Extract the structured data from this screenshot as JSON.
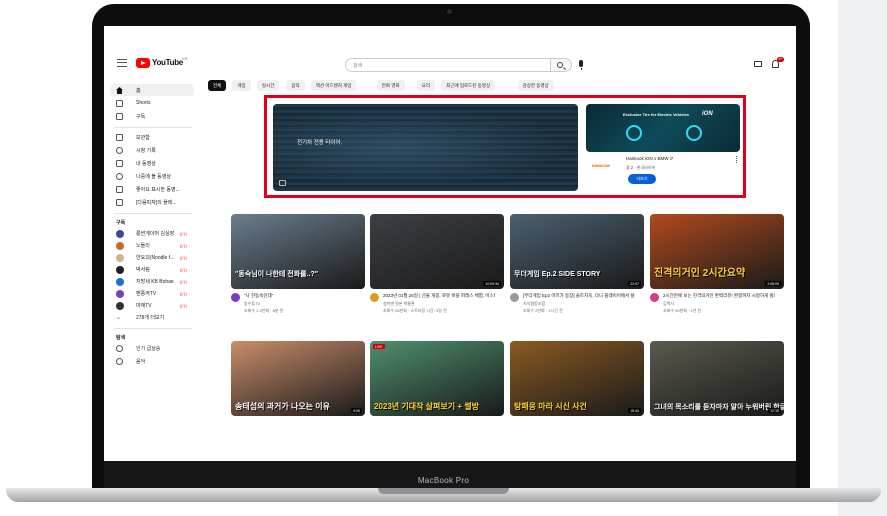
{
  "device": {
    "label": "MacBook Pro"
  },
  "header": {
    "logo_text": "YouTube",
    "region": "KR",
    "search_placeholder": "검색",
    "notification_count": "9+"
  },
  "sidebar": {
    "primary": [
      {
        "label": "홈",
        "icon": "home-icon"
      },
      {
        "label": "Shorts",
        "icon": "shorts-icon"
      },
      {
        "label": "구독",
        "icon": "subscriptions-icon"
      }
    ],
    "library": [
      {
        "label": "보관함",
        "icon": "library-icon"
      },
      {
        "label": "시청 기록",
        "icon": "history-icon"
      },
      {
        "label": "내 동영상",
        "icon": "my-videos-icon"
      },
      {
        "label": "나중에 볼 동영상",
        "icon": "watch-later-icon"
      },
      {
        "label": "좋아요 표시한 동영...",
        "icon": "liked-icon"
      },
      {
        "label": "[다음피자]의 플레...",
        "icon": "playlist-icon"
      }
    ],
    "subscriptions_heading": "구독",
    "subscriptions": [
      {
        "label": "롱썬게이머 김실장",
        "color": "#3a4a8a"
      },
      {
        "label": "노돌리",
        "color": "#c46a2e"
      },
      {
        "label": "얀요괴(Noodle f...",
        "color": "#d5b08a"
      },
      {
        "label": "박서림",
        "color": "#222222"
      },
      {
        "label": "지방세 KB Bohae",
        "color": "#1f6fd1"
      },
      {
        "label": "밴쭝켜TV",
        "color": "#7a3fb8"
      },
      {
        "label": "마재TV",
        "color": "#333333"
      }
    ],
    "show_more": "278개 더보기",
    "explore_heading": "탐색",
    "explore": [
      {
        "label": "인기 급상승",
        "icon": "trending-icon"
      },
      {
        "label": "음악",
        "icon": "music-icon"
      }
    ]
  },
  "chips": [
    "전체",
    "게임",
    "실시간",
    "음악",
    "액션 어드벤처 게임",
    "만화 영화",
    "요리",
    "최근에 업로드된 동영상",
    "감상한 동영상"
  ],
  "ad": {
    "video_text": "전기차 전용 타이어.",
    "card_caption": "Exclusive Tire for Electric Vehicles",
    "card_brand": "iON",
    "logo_text": "HANKOOK",
    "title": "Hankook iON x BMW i7",
    "sponsor": "광고 · 한국타이어",
    "cta": "더보기"
  },
  "videos": [
    {
      "title": "\"나 한동숙인데\"",
      "channel": "동수튜TV",
      "meta": "조회수 1.3만회 · 8분 전",
      "thumb_text": "\"동숙님이 나한테 전화를..?\"",
      "thumb_bg": "#6b7e8e",
      "avatar": "#7a3fb8"
    },
    {
      "title": "2023년 01월 25일 | 선물 개봉, 로봇 버블 퍼레스 체험, 마스터 메그 대탐험, 비즈 ...",
      "channel": "침착맨 원본 박물관",
      "meta": "조회수 26만회 · 스트리밍 시간: 3일 전",
      "thumb_text": "",
      "duration": "10:09:34",
      "thumb_bg": "#3c3f44",
      "avatar": "#d4a017"
    },
    {
      "title": "[무더게임 Ep2 마르가 등장] 솔트지옥, 다니 플레이어에서 탈출하라",
      "channel": "지식협동조합",
      "meta": "조회수 2만회 · 1시간 전",
      "thumb_text": "무더게임 Ep.2  SIDE STORY",
      "duration": "22:07",
      "thumb_bg": "#4b6070",
      "avatar": "#999999"
    },
    {
      "title": "2시간만에 보는 진격의거인 완벽리뷰! 완결까지 시청하게 될리까 [진격의거인 ...",
      "channel": "김백사",
      "meta": "조회수 90만회 · 1년 전",
      "thumb_text": "진격의거인 2시간요약",
      "duration": "2:08:09",
      "thumb_bg": "#b14a1d",
      "avatar": "#d63a8a"
    },
    {
      "title": "",
      "channel": "",
      "meta": "",
      "thumb_text": "송태섭의 과거가 나오는 이유",
      "duration": "9:05",
      "thumb_bg": "#c98d6a",
      "avatar": "#aaaaaa"
    },
    {
      "title": "",
      "channel": "",
      "meta": "",
      "thumb_text": "2023년 기대작 살펴보기 + 썰방",
      "badge": "LIVE",
      "thumb_bg": "#4f8f6f",
      "avatar": "#aaaaaa"
    },
    {
      "title": "",
      "channel": "",
      "meta": "",
      "thumb_text": "탕패웅 마라 시신 사건",
      "duration": "15:44",
      "thumb_bg": "#8a5a22",
      "avatar": "#aaaaaa"
    },
    {
      "title": "",
      "channel": "",
      "meta": "",
      "thumb_text": "그녀의 목소리를 듣자마자 알아 누워버린 한글자",
      "duration": "12:10",
      "thumb_bg": "#5a5a4e",
      "avatar": "#aaaaaa"
    }
  ],
  "colors": {
    "accent": "#ff0000",
    "highlight": "#e0001b",
    "cta": "#065fd4"
  }
}
